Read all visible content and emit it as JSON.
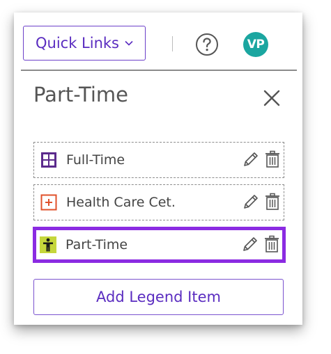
{
  "topbar": {
    "quick_links_label": "Quick Links",
    "chevron_icon": "chevron-down-icon",
    "help_icon": "help-circle-icon",
    "avatar_initials": "VP",
    "avatar_color": "#1ba6a0",
    "accent_color": "#5a2cc0"
  },
  "panel": {
    "title": "Part-Time",
    "close_icon": "close-icon"
  },
  "legend": {
    "items": [
      {
        "label": "Full-Time",
        "icon": "grid-icon",
        "color": "#5b2a8c",
        "selected": false
      },
      {
        "label": "Health Care Cet.",
        "icon": "plus-box-icon",
        "color": "#e0512b",
        "selected": false
      },
      {
        "label": "Part-Time",
        "icon": "person-icon",
        "color": "#c5d63c",
        "selected": true
      }
    ],
    "selected_border_color": "#8b2be2"
  },
  "actions": {
    "add_label": "Add Legend Item"
  }
}
